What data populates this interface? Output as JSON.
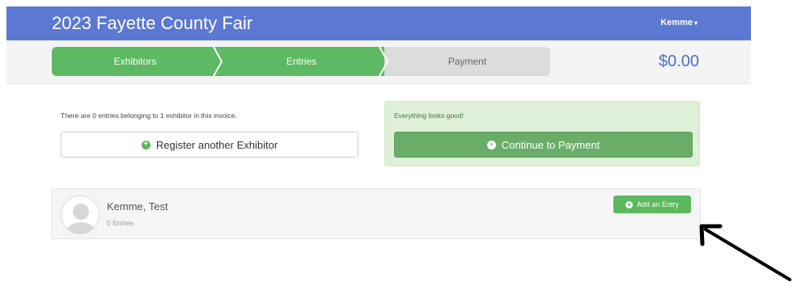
{
  "header": {
    "title": "2023 Fayette County Fair",
    "user": "Kemme",
    "user_caret": "▾"
  },
  "steps": [
    {
      "label": "Exhibitors",
      "state": "complete"
    },
    {
      "label": "Entries",
      "state": "complete"
    },
    {
      "label": "Payment",
      "state": "pending"
    }
  ],
  "total": "$0.00",
  "invoice": {
    "summary_text": "There are 0 entries belonging to 1 exhibitor in this invoice.",
    "register_button": "Register another Exhibitor",
    "register_icon": "plus-circle-icon"
  },
  "status": {
    "message": "Everything looks good!",
    "continue_button": "Continue to Payment",
    "continue_icon": "arrow-right-circle-icon"
  },
  "exhibitor": {
    "name": "Kemme, Test",
    "entries": "0 Entries",
    "add_button": "Add an Entry",
    "add_icon": "plus-circle-icon"
  },
  "colors": {
    "navbar": "#5b78d2",
    "step_complete": "#5db962",
    "step_pending": "#dcdcdc",
    "success_bg": "#dff0d8",
    "button_green": "#69ad69",
    "total_text": "#4a6fcf"
  }
}
